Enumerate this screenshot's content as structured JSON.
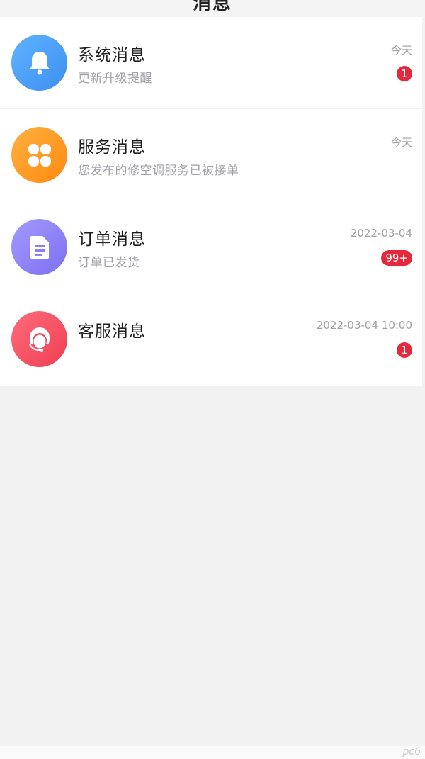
{
  "header": {
    "title": "消息"
  },
  "messages": [
    {
      "title": "系统消息",
      "subtitle": "更新升级提醒",
      "time": "今天",
      "badge": "1",
      "icon": "bell-icon",
      "color": "#4a9cf6"
    },
    {
      "title": "服务消息",
      "subtitle": "您发布的修空调服务已被接单",
      "time": "今天",
      "badge": "",
      "icon": "clover-icon",
      "color": "#ff9a22"
    },
    {
      "title": "订单消息",
      "subtitle": "订单已发货",
      "time": "2022-03-04",
      "badge": "99+",
      "icon": "document-icon",
      "color": "#8a7ff6"
    },
    {
      "title": "客服消息",
      "subtitle": "",
      "time": "2022-03-04  10:00",
      "badge": "1",
      "icon": "customer-service-icon",
      "color": "#f04a5e"
    }
  ],
  "watermark": "pc6"
}
